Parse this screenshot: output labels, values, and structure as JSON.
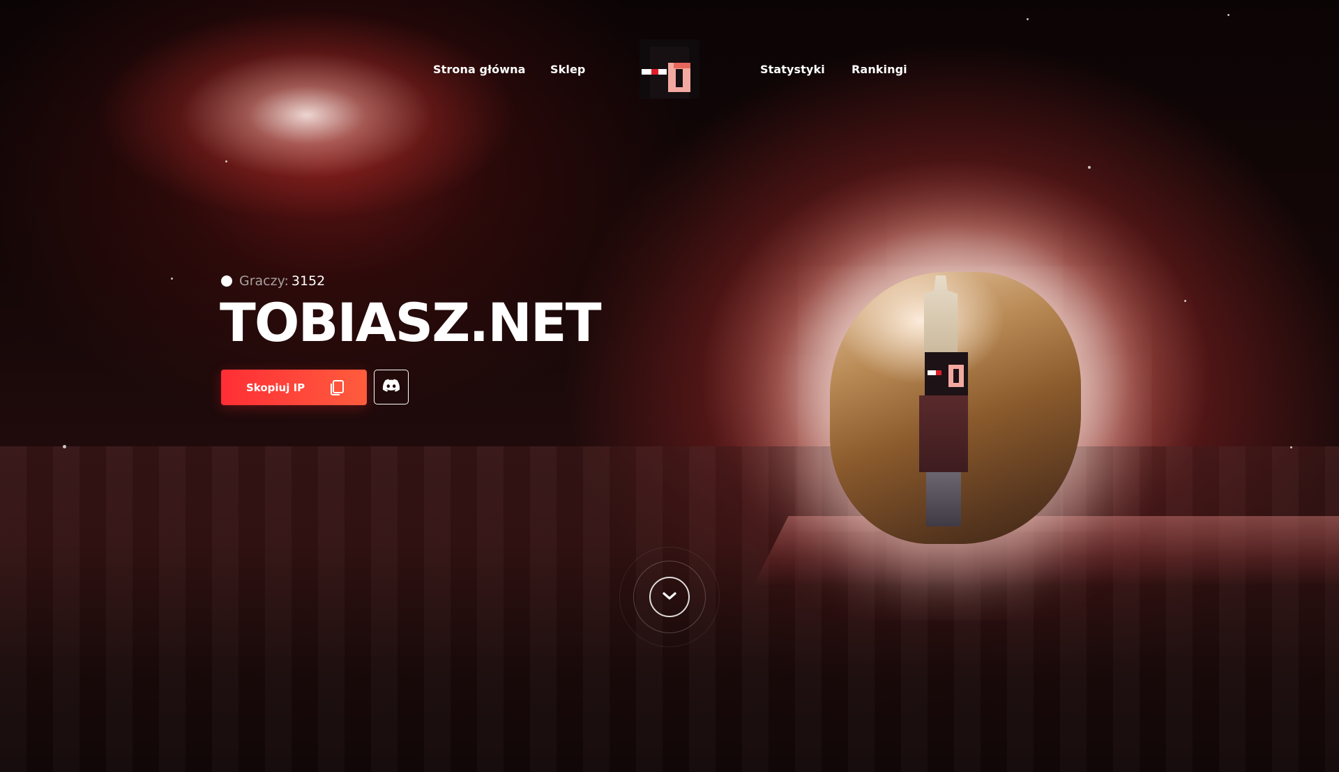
{
  "nav": {
    "left": [
      {
        "label": "Strona główna"
      },
      {
        "label": "Sklep"
      }
    ],
    "right": [
      {
        "label": "Statystyki"
      },
      {
        "label": "Rankingi"
      }
    ],
    "logo_icon": "pixel-skin-face-icon"
  },
  "hero": {
    "players_label": "Graczy:",
    "players_count": "3152",
    "title": "TOBIASZ.NET",
    "copy_button_label": "Skopiuj IP",
    "copy_icon": "copy-icon",
    "discord_icon": "discord-icon"
  },
  "scroll": {
    "icon": "chevron-down-icon"
  },
  "colors": {
    "accent": "#ff3a38",
    "background": "#120708",
    "text": "#ffffff",
    "muted": "#a9a0a0"
  }
}
